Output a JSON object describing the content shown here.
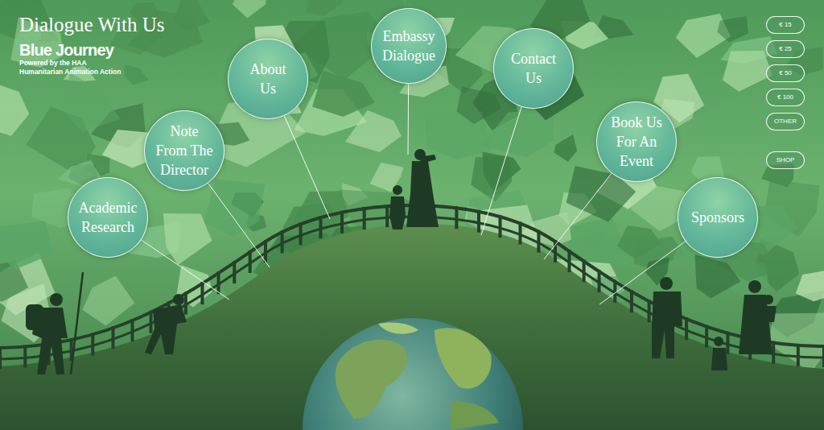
{
  "header": {
    "title": "Dialogue With Us",
    "brand": "Blue Journey",
    "tagline": [
      "Powered by the HAA",
      "Humanitarian Animation Action"
    ]
  },
  "nav": [
    {
      "label": "Academic Research"
    },
    {
      "label": "Note From The Director"
    },
    {
      "label": "About Us"
    },
    {
      "label": "Embassy Dialogue"
    },
    {
      "label": "Contact Us"
    },
    {
      "label": "Book Us For An Event"
    },
    {
      "label": "Sponsors"
    }
  ],
  "donate": [
    {
      "label": "€ 15"
    },
    {
      "label": "€ 25"
    },
    {
      "label": "€ 50"
    },
    {
      "label": "€ 100"
    },
    {
      "label": "OTHER"
    }
  ],
  "shop": {
    "label": "SHOP"
  }
}
